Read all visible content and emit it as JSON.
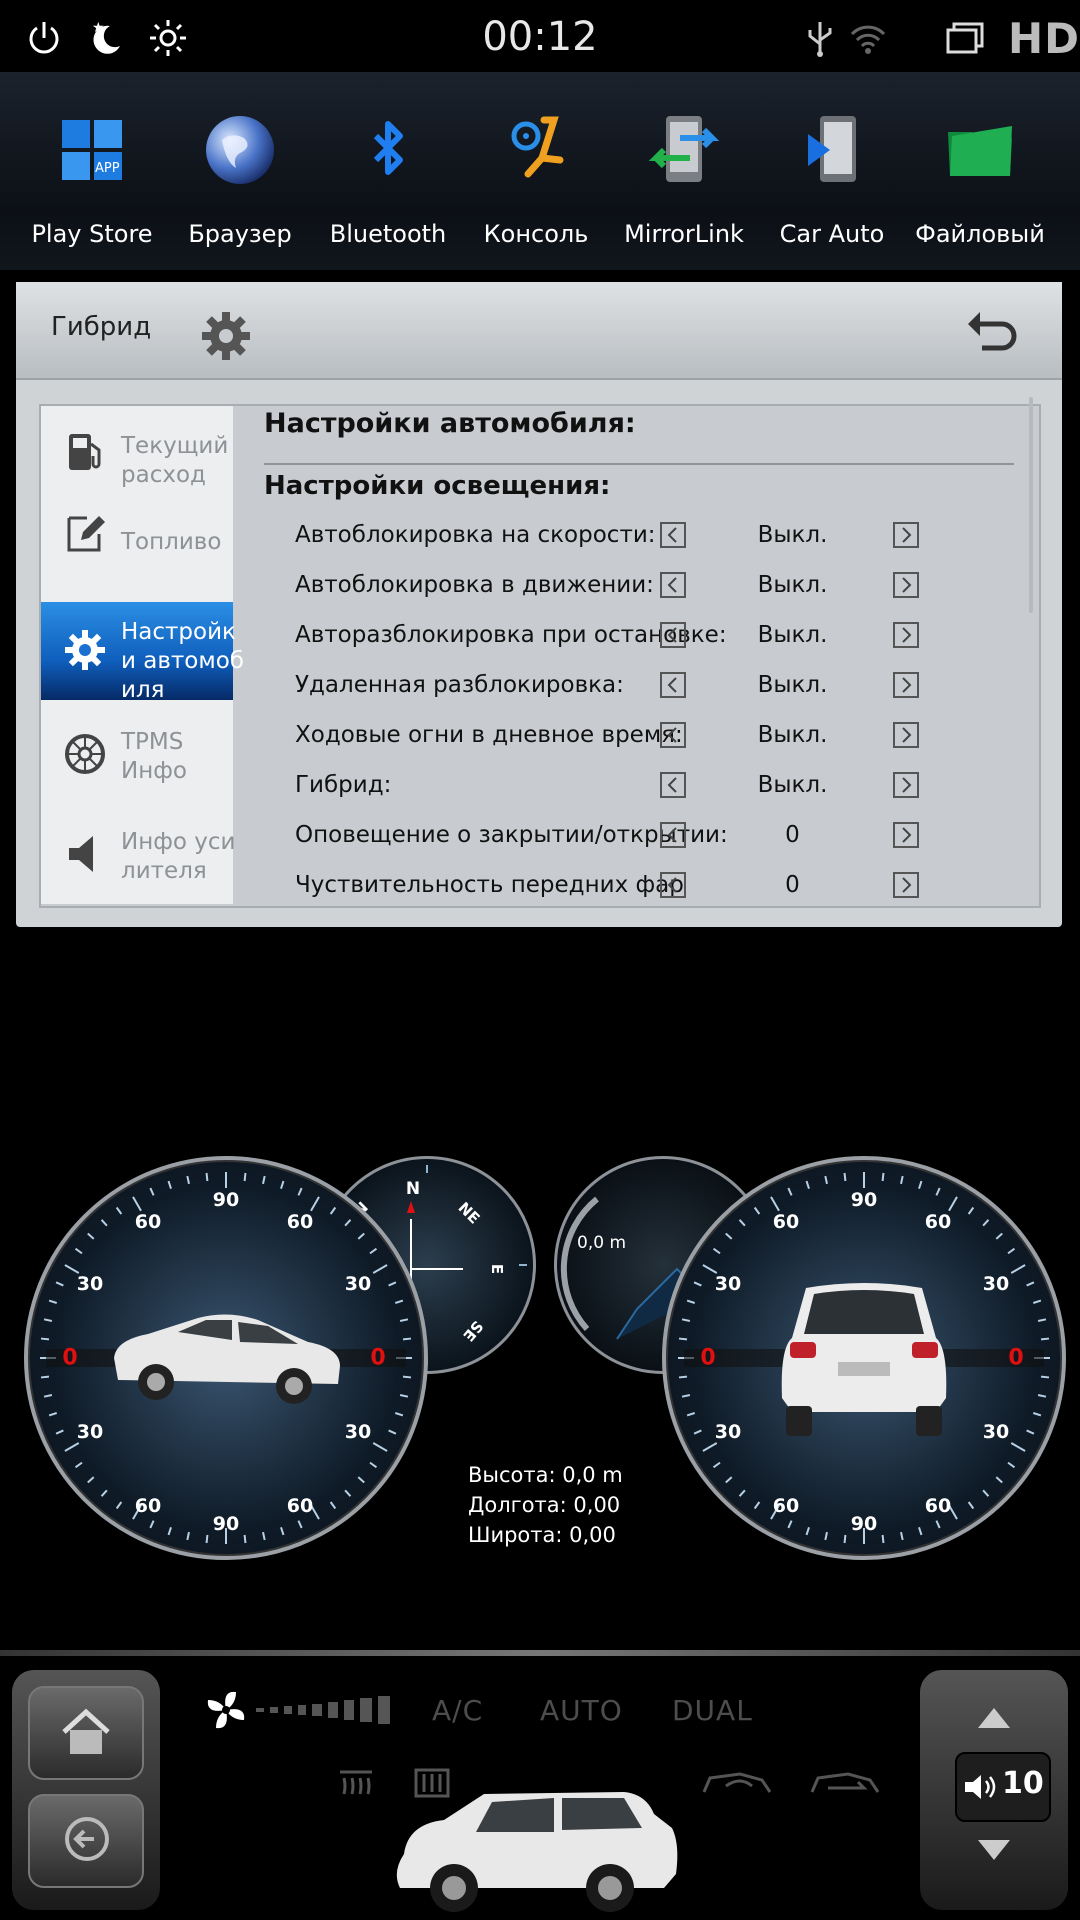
{
  "status_bar": {
    "time": "00:12",
    "resolution_badge": "HD",
    "icons": [
      "power-icon",
      "night-mode-icon",
      "brightness-icon",
      "usb-icon",
      "wifi-icon",
      "recent-apps-icon"
    ]
  },
  "dock": {
    "apps": [
      {
        "label": "Play Store",
        "icon": "app-store-icon"
      },
      {
        "label": "Браузер",
        "icon": "globe-icon"
      },
      {
        "label": "Bluetooth",
        "icon": "bluetooth-icon"
      },
      {
        "label": "Консоль",
        "icon": "steering-wheel-icon"
      },
      {
        "label": "MirrorLink",
        "icon": "mirrorlink-icon"
      },
      {
        "label": "Car Auto",
        "icon": "car-auto-icon"
      },
      {
        "label": "Файловый",
        "icon": "folder-icon"
      }
    ]
  },
  "settings_window": {
    "title": "Гибрид",
    "menu": [
      {
        "label": "Текущий\nрасход",
        "icon": "fuel-pump-icon",
        "active": false
      },
      {
        "label": "Топливо",
        "icon": "edit-note-icon",
        "active": false
      },
      {
        "label": "Настройк\nи автомоб\nиля",
        "icon": "gear-icon",
        "active": true
      },
      {
        "label": "TPMS\nИнфо",
        "icon": "tire-icon",
        "active": false
      },
      {
        "label": "Инфо уси\nлителя",
        "icon": "speaker-icon",
        "active": false
      }
    ],
    "heading": "Настройки автомобиля:",
    "subheading": "Настройки освещения:",
    "rows": [
      {
        "label": "Автоблокировка на скорости:",
        "value": "Выкл."
      },
      {
        "label": "Автоблокировка в движении:",
        "value": "Выкл."
      },
      {
        "label": "Авторазблокировка при остановке:",
        "value": "Выкл."
      },
      {
        "label": "Удаленная разблокировка:",
        "value": "Выкл."
      },
      {
        "label": "Ходовые огни в дневное время:",
        "value": "Выкл."
      },
      {
        "label": "Гибрид:",
        "value": "Выкл."
      },
      {
        "label": "Оповещение о закрытии/открытии:",
        "value": "0"
      },
      {
        "label": "Чуствительность передних фар",
        "value": "0"
      }
    ]
  },
  "gauges": {
    "tilt_left": {
      "top": "90",
      "upper_left": "60",
      "upper_right": "60",
      "mid_left": "30",
      "mid_right": "30",
      "zero_left": "0",
      "zero_right": "0",
      "lower_left": "30",
      "lower_right": "30",
      "bottom_left": "60",
      "bottom_right": "60",
      "bottom": "90"
    },
    "tilt_right": {
      "top": "90",
      "upper_left": "60",
      "upper_right": "60",
      "mid_left": "30",
      "mid_right": "30",
      "zero_left": "0",
      "zero_right": "0",
      "lower_left": "30",
      "lower_right": "30",
      "bottom_left": "60",
      "bottom_right": "60",
      "bottom": "90"
    },
    "compass": {
      "n": "N",
      "ne": "NE",
      "e": "E",
      "se": "SE",
      "nw": "N"
    },
    "altimeter": {
      "label": "0,0 m"
    },
    "gps": {
      "altitude": "Высота: 0,0 m",
      "longitude": "Долгота: 0,00",
      "latitude": "Широта: 0,00"
    }
  },
  "climate": {
    "ac": "A/C",
    "auto": "AUTO",
    "dual": "DUAL",
    "fan_level": 0
  },
  "volume": {
    "level": "10"
  }
}
